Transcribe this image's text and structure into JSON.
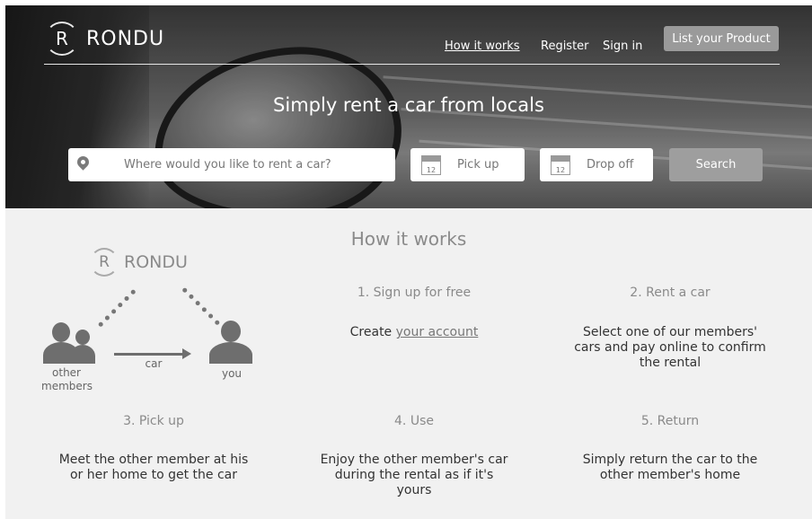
{
  "brand": {
    "mark": "R",
    "name": "RONDU"
  },
  "nav": {
    "how_it_works": "How it works",
    "register": "Register",
    "sign_in": "Sign in",
    "list_product": "List your Product"
  },
  "hero": {
    "tagline": "Simply rent a car from locals",
    "search_placeholder": "Where would you like to rent a car?",
    "pickup_label": "Pick up",
    "dropoff_label": "Drop off",
    "calendar_day": "12",
    "search_button": "Search"
  },
  "how": {
    "title": "How it works",
    "diagram": {
      "brand_mark": "R",
      "brand_name": "RONDU",
      "others_label_1": "other",
      "others_label_2": "members",
      "car_label": "car",
      "you_label": "you"
    },
    "steps": [
      {
        "title": "1. Sign up for free",
        "text_prefix": "Create ",
        "text_link": "your account"
      },
      {
        "title": "2. Rent a car",
        "text_1": "Select one of our members'",
        "text_2": "cars and pay online to confirm",
        "text_3": "the rental"
      },
      {
        "title": "3. Pick up",
        "text_1": "Meet the other member at his",
        "text_2": "or her home to get the car"
      },
      {
        "title": "4. Use",
        "text_1": "Enjoy the other member's car",
        "text_2": "during the rental as if it's",
        "text_3": "yours"
      },
      {
        "title": "5. Return",
        "text_1": "Simply return the car to the",
        "text_2": "other member's home"
      }
    ]
  },
  "colors": {
    "hero_button": "#9e9e9e",
    "section_bg": "#f1f1f1",
    "icon_gray": "#6e6e6e"
  }
}
